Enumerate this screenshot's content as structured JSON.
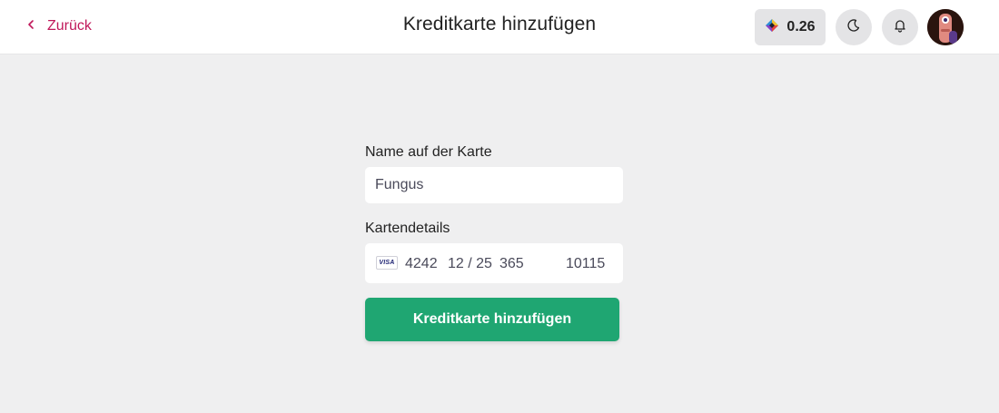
{
  "header": {
    "back_label": "Zurück",
    "title": "Kreditkarte hinzufügen",
    "credits": "0.26",
    "back_icon": "chevron-left-icon",
    "credit_icon": "gem-icon",
    "theme_icon": "moon-icon",
    "notification_icon": "bell-icon"
  },
  "form": {
    "name_label": "Name auf der Karte",
    "name_value": "Fungus",
    "card_label": "Kartendetails",
    "card": {
      "brand": "VISA",
      "number": "4242",
      "expiry": "12 / 25",
      "cvc": "365",
      "postal": "10115"
    },
    "submit_label": "Kreditkarte hinzufügen"
  },
  "colors": {
    "accent": "#c0185a",
    "primary_button": "#1fa672",
    "background": "#efeff0"
  }
}
